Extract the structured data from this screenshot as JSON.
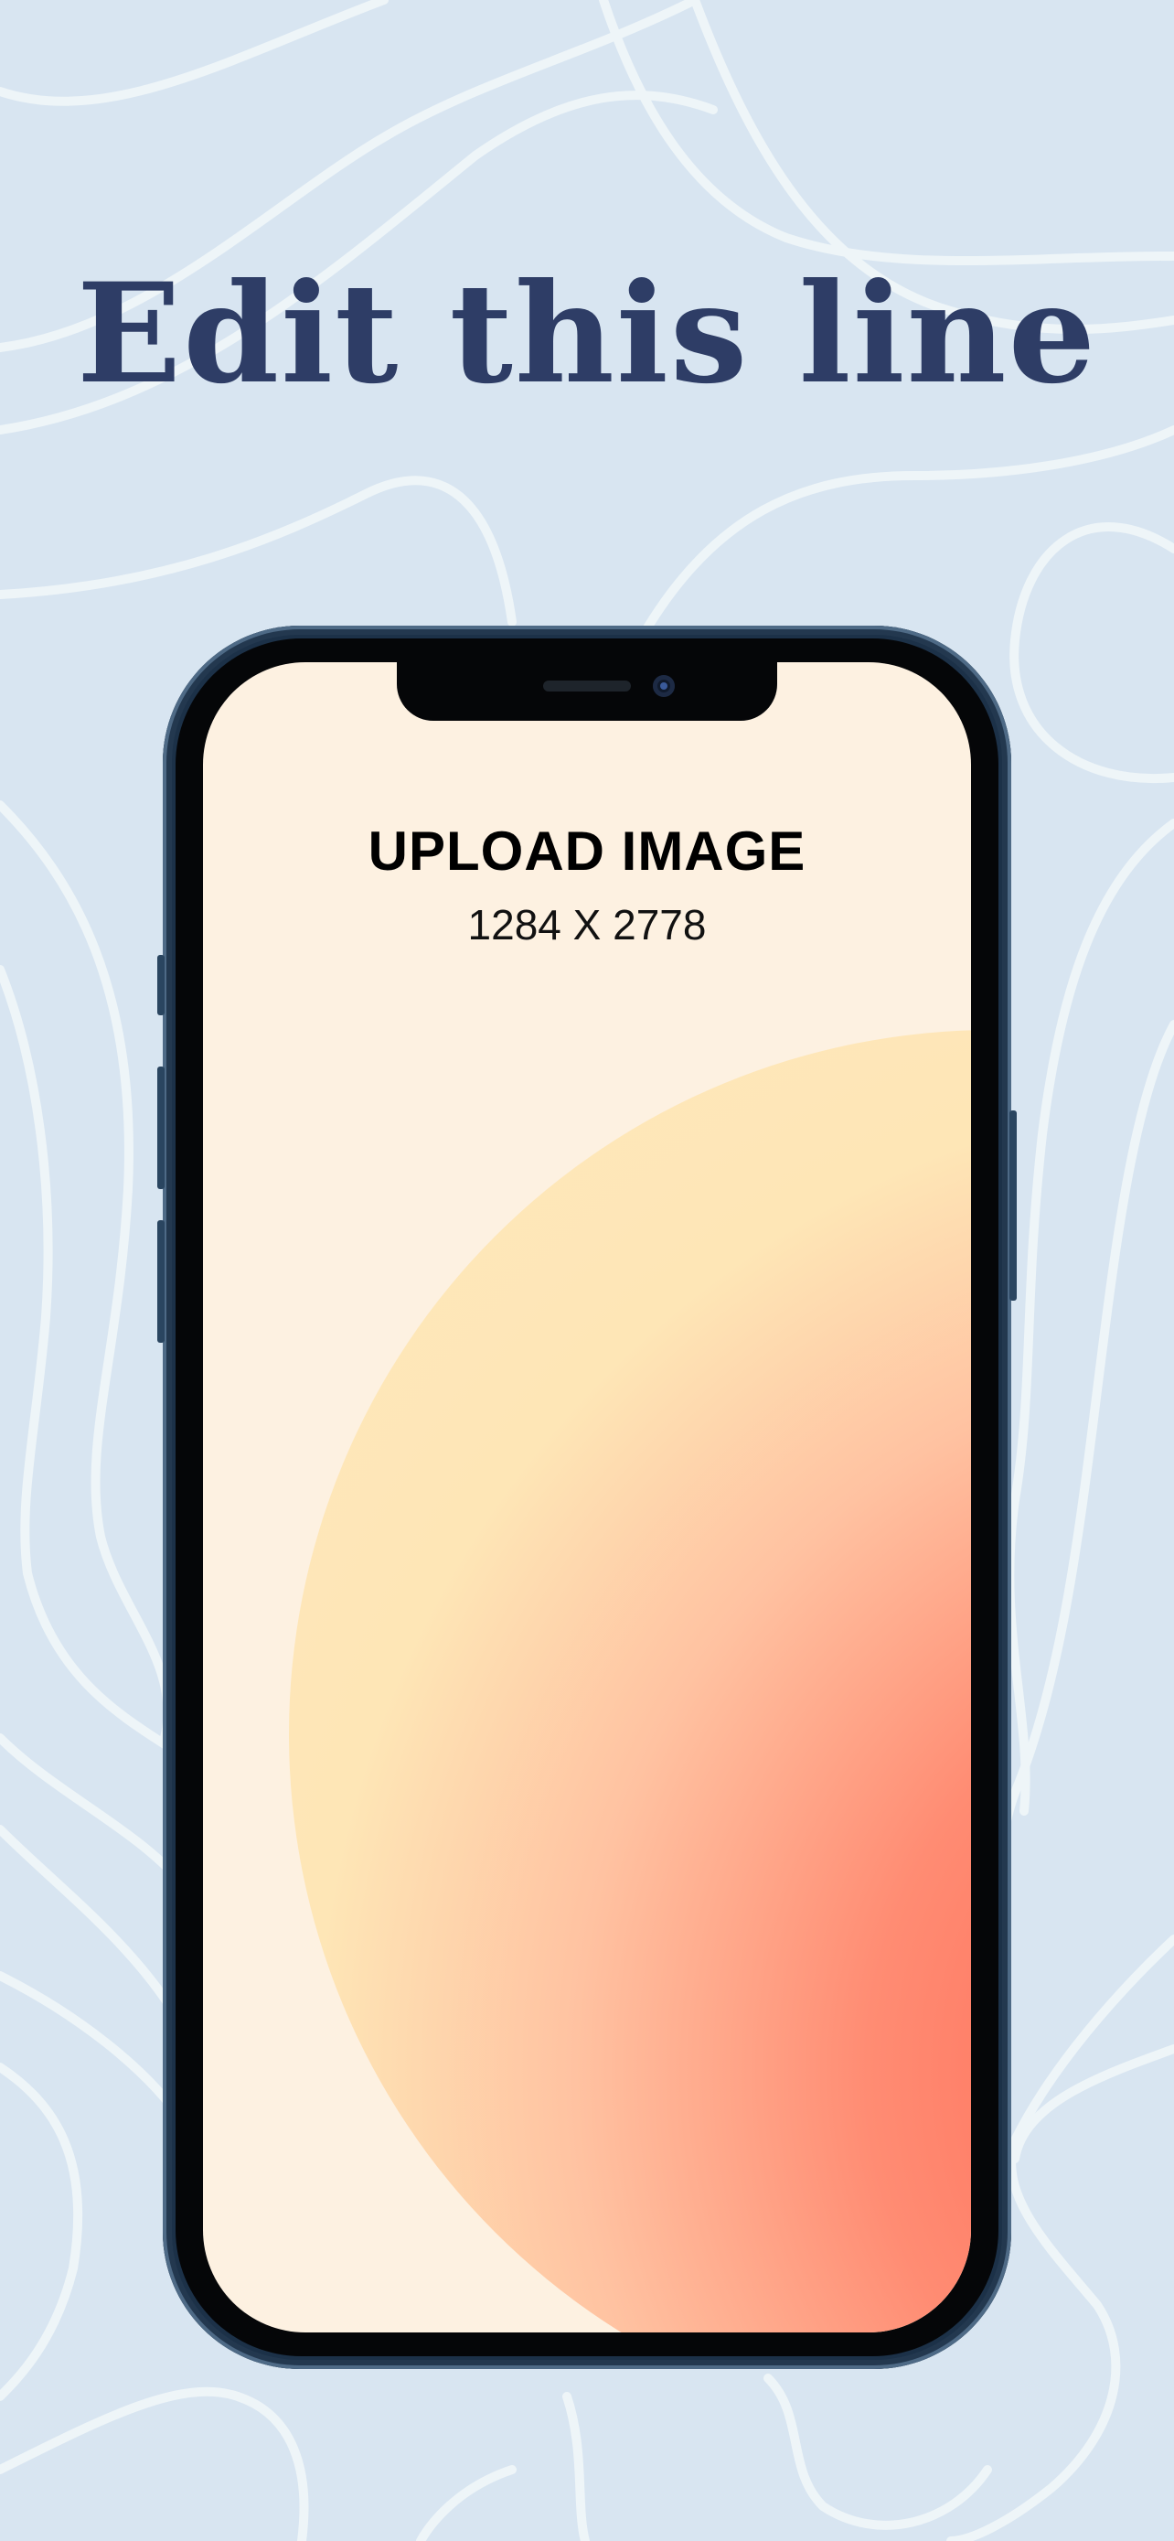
{
  "headline": {
    "text": "Edit this line"
  },
  "screen_placeholder": {
    "title": "UPLOAD IMAGE",
    "dimensions": "1284 X 2778"
  },
  "colors": {
    "background": "#d8e5f1",
    "headline": "#2e3d66",
    "screen_base": "#fdf1e1",
    "gradient_warm": "#ff5f4d",
    "gradient_light": "#fee6b6"
  },
  "icons": {
    "front_camera": "front-camera-icon",
    "speaker": "earpiece-speaker-icon"
  }
}
